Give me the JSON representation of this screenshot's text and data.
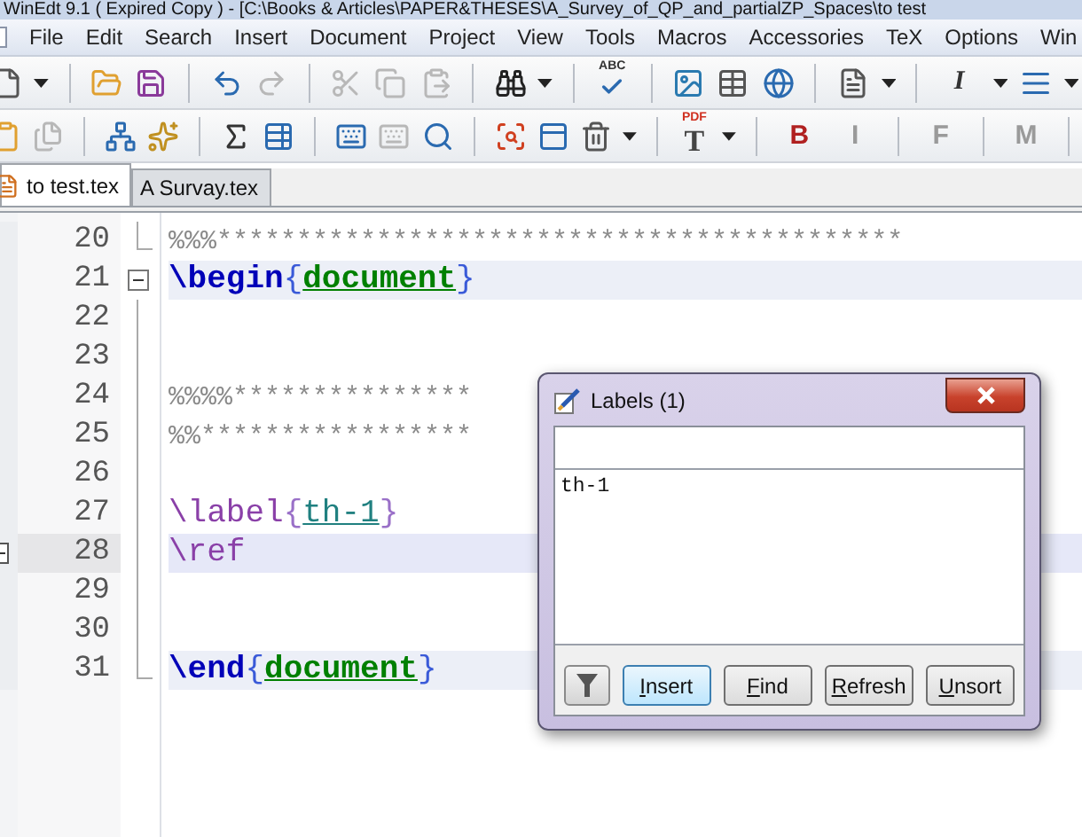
{
  "window": {
    "title": "WinEdt 9.1  ( Expired  Copy )  - [C:\\Books & Articles\\PAPER&THESES\\A_Survey_of_QP_and_partialZP_Spaces\\to test"
  },
  "menu": [
    "File",
    "Edit",
    "Search",
    "Insert",
    "Document",
    "Project",
    "View",
    "Tools",
    "Macros",
    "Accessories",
    "TeX",
    "Options",
    "Win"
  ],
  "toolbars": [
    {
      "items": [
        {
          "kind": "icon",
          "disabled": false
        },
        {
          "kind": "drop"
        },
        {
          "kind": "sep"
        },
        {
          "kind": "icon",
          "disabled": false
        },
        {
          "kind": "icon",
          "disabled": false
        },
        {
          "kind": "sep"
        },
        {
          "kind": "icon",
          "disabled": false
        },
        {
          "kind": "icon",
          "disabled": true
        },
        {
          "kind": "sep"
        },
        {
          "kind": "icon",
          "disabled": true
        },
        {
          "kind": "icon",
          "disabled": true
        },
        {
          "kind": "icon",
          "disabled": true
        },
        {
          "kind": "sep"
        },
        {
          "kind": "icon",
          "disabled": false
        },
        {
          "kind": "drop"
        },
        {
          "kind": "sep"
        },
        {
          "kind": "spell",
          "text": "ABC"
        },
        {
          "kind": "sep"
        },
        {
          "kind": "icon",
          "disabled": false
        },
        {
          "kind": "icon",
          "disabled": false
        },
        {
          "kind": "icon",
          "disabled": false
        },
        {
          "kind": "sep"
        },
        {
          "kind": "icon",
          "disabled": false
        },
        {
          "kind": "drop"
        },
        {
          "kind": "sep"
        },
        {
          "kind": "italic",
          "text": "I"
        },
        {
          "kind": "drop"
        },
        {
          "kind": "icon",
          "disabled": false
        },
        {
          "kind": "drop"
        }
      ]
    },
    {
      "items": [
        {
          "kind": "icon",
          "disabled": false
        },
        {
          "kind": "icon",
          "disabled": true
        },
        {
          "kind": "sep"
        },
        {
          "kind": "icon",
          "disabled": false
        },
        {
          "kind": "icon",
          "disabled": false
        },
        {
          "kind": "sep"
        },
        {
          "kind": "icon",
          "disabled": false
        },
        {
          "kind": "icon",
          "disabled": false
        },
        {
          "kind": "sep"
        },
        {
          "kind": "icon",
          "disabled": false
        },
        {
          "kind": "icon",
          "disabled": true
        },
        {
          "kind": "icon",
          "disabled": false
        },
        {
          "kind": "sep"
        },
        {
          "kind": "icon",
          "disabled": false
        },
        {
          "kind": "icon",
          "disabled": false
        },
        {
          "kind": "icon",
          "disabled": false
        },
        {
          "kind": "drop"
        },
        {
          "kind": "sep"
        },
        {
          "kind": "pdf",
          "top": "PDF",
          "main": "T"
        },
        {
          "kind": "drop"
        },
        {
          "kind": "sep"
        },
        {
          "kind": "letter",
          "text": "B",
          "disabled": false
        },
        {
          "kind": "letter",
          "text": "I",
          "disabled": true
        },
        {
          "kind": "sep"
        },
        {
          "kind": "letter",
          "text": "F",
          "disabled": true
        },
        {
          "kind": "sep"
        },
        {
          "kind": "letter",
          "text": "M",
          "disabled": true
        },
        {
          "kind": "sep"
        }
      ]
    }
  ],
  "tabs": [
    {
      "label": "to test.tex",
      "selected": true
    },
    {
      "label": "A Survay.tex",
      "selected": false
    }
  ],
  "lines": [
    {
      "number": "20",
      "kind": "fold-end",
      "current": false,
      "shaded": false,
      "bookmark": false,
      "tokens": [
        {
          "kind": "comment",
          "text": "%%%*******************************************"
        }
      ]
    },
    {
      "number": "21",
      "kind": "fold-start",
      "current": false,
      "shaded": true,
      "bookmark": false,
      "tokens": [
        {
          "kind": "keyword",
          "text": "\\begin"
        },
        {
          "kind": "brace",
          "text": "{"
        },
        {
          "kind": "env",
          "text": "document"
        },
        {
          "kind": "brace",
          "text": "}"
        }
      ]
    },
    {
      "number": "22",
      "kind": "fold-inside",
      "current": false,
      "shaded": false,
      "bookmark": false
    },
    {
      "number": "23",
      "kind": "fold-inside",
      "current": false,
      "shaded": false,
      "bookmark": false
    },
    {
      "number": "24",
      "kind": "fold-inside",
      "current": false,
      "shaded": false,
      "bookmark": false,
      "tokens": [
        {
          "kind": "comment",
          "text": "%%%%***************"
        }
      ]
    },
    {
      "number": "25",
      "kind": "fold-inside",
      "current": false,
      "shaded": false,
      "bookmark": false,
      "tokens": [
        {
          "kind": "comment",
          "text": "%%*****************"
        }
      ]
    },
    {
      "number": "26",
      "kind": "fold-inside",
      "current": false,
      "shaded": false,
      "bookmark": false
    },
    {
      "number": "27",
      "kind": "fold-inside",
      "current": false,
      "shaded": false,
      "bookmark": false,
      "tokens": [
        {
          "kind": "macro",
          "text": "\\label"
        },
        {
          "kind": "macro-brace",
          "text": "{"
        },
        {
          "kind": "ref",
          "text": "th-1"
        },
        {
          "kind": "macro-brace",
          "text": "}"
        }
      ]
    },
    {
      "number": "28",
      "kind": "fold-inside",
      "current": true,
      "shaded": false,
      "bookmark": true,
      "tokens": [
        {
          "kind": "macro",
          "text": "\\ref"
        }
      ]
    },
    {
      "number": "29",
      "kind": "fold-inside",
      "current": false,
      "shaded": false,
      "bookmark": false
    },
    {
      "number": "30",
      "kind": "fold-inside",
      "current": false,
      "shaded": false,
      "bookmark": false
    },
    {
      "number": "31",
      "kind": "fold-end",
      "current": false,
      "shaded": true,
      "bookmark": false,
      "tokens": [
        {
          "kind": "keyword",
          "text": "\\end"
        },
        {
          "kind": "brace",
          "text": "{"
        },
        {
          "kind": "env",
          "text": "document"
        },
        {
          "kind": "brace",
          "text": "}"
        }
      ]
    }
  ],
  "dialog": {
    "title": "Labels",
    "count": "(1)",
    "items": [
      "th-1"
    ],
    "buttons": [
      {
        "label": "Insert",
        "default": true,
        "mnemonic": true
      },
      {
        "label": "Find",
        "default": false,
        "mnemonic": true
      },
      {
        "label": "Refresh",
        "default": false,
        "mnemonic": true
      },
      {
        "label": "Unsort",
        "default": false,
        "mnemonic": true
      }
    ]
  }
}
